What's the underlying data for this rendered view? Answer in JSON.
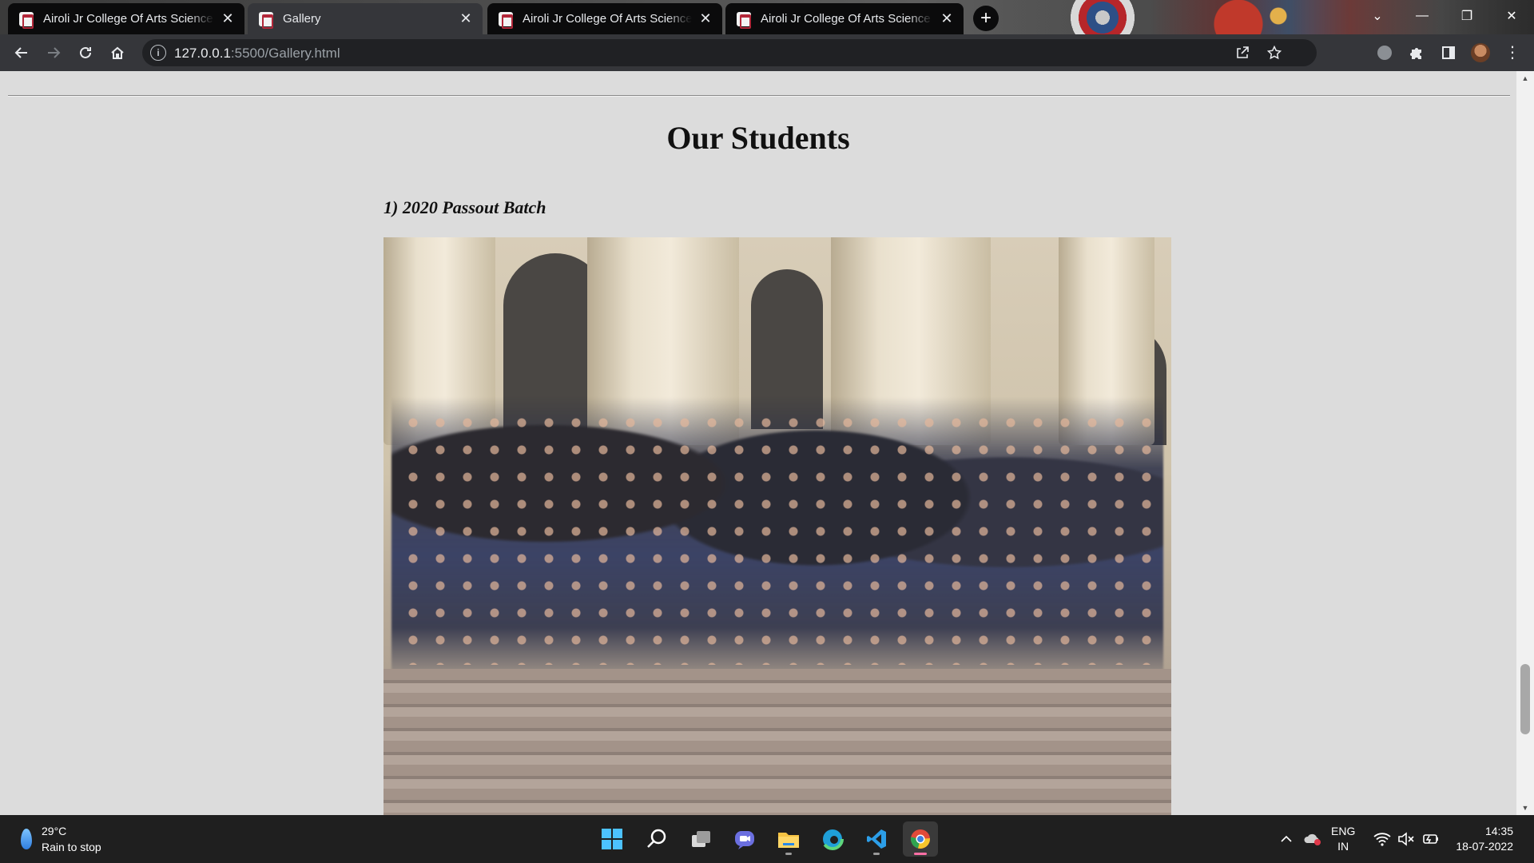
{
  "browser": {
    "tabs": [
      {
        "title": "Airoli Jr College Of Arts Science / ",
        "state": "dark"
      },
      {
        "title": "Gallery",
        "state": "active"
      },
      {
        "title": "Airoli Jr College Of Arts Science / ",
        "state": "dark"
      },
      {
        "title": "Airoli Jr College Of Arts Science / ",
        "state": "dark"
      }
    ],
    "new_tab_label": "+",
    "url_host": "127.0.0.1",
    "url_rest": ":5500/Gallery.html"
  },
  "page": {
    "heading": "Our Students",
    "subheading": "1) 2020 Passout Batch"
  },
  "taskbar": {
    "weather_temp": "29°C",
    "weather_desc": "Rain to stop",
    "lang_line1": "ENG",
    "lang_line2": "IN",
    "time": "14:35",
    "date": "18-07-2022"
  },
  "colors": {
    "page_bg": "#dcdcdc",
    "toolbar_bg": "#35363a",
    "active_tab_bg": "#35363a",
    "taskbar_bg": "#1f1f1f",
    "favicon_accent": "#b2283a"
  },
  "icons": [
    "back-icon",
    "forward-icon",
    "reload-icon",
    "home-icon",
    "site-info-icon",
    "share-icon",
    "bookmark-star-icon",
    "extension-icon",
    "puzzle-icon",
    "side-panel-icon",
    "profile-avatar",
    "menu-icon",
    "windows-start-icon",
    "search-icon",
    "task-view-icon",
    "chat-icon",
    "file-explorer-icon",
    "edge-icon",
    "vscode-icon",
    "chrome-icon",
    "chevron-up-icon",
    "onedrive-icon",
    "wifi-icon",
    "volume-muted-icon",
    "battery-icon"
  ]
}
